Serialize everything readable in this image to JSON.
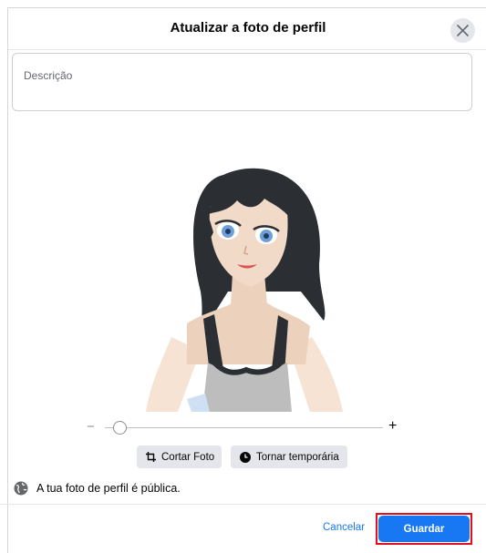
{
  "dialog": {
    "title": "Atualizar a foto de perfil"
  },
  "description": {
    "placeholder": "Descrição"
  },
  "photo": {
    "subject": "avatar-illustration-woman-black-hair"
  },
  "zoom": {
    "minus_label": "−",
    "plus_label": "+",
    "level": 0.03
  },
  "actions": {
    "crop_label": "Cortar Foto",
    "temporary_label": "Tornar temporária"
  },
  "privacy": {
    "note": "A tua foto de perfil é pública."
  },
  "footer": {
    "cancel_label": "Cancelar",
    "save_label": "Guardar"
  },
  "colors": {
    "primary": "#1877f2",
    "highlight": "#e0101c",
    "button_bg": "#e4e6eb"
  }
}
